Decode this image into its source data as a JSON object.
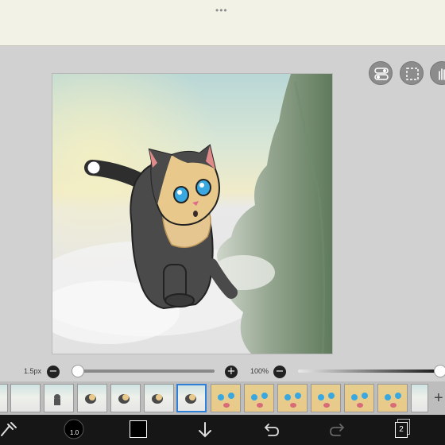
{
  "top_bar": {
    "grip_icon": "more-horizontal-icon"
  },
  "tools": {
    "icons": [
      "toggle-icon",
      "selection-icon",
      "hand-icon"
    ]
  },
  "brush": {
    "size_label": "1.5px",
    "size_level_fraction": 0.0,
    "opacity_label": "100%",
    "opacity_level_fraction": 1.0
  },
  "frames": {
    "count_visible": 13,
    "selected_index": 5,
    "add_icon": "plus-icon"
  },
  "bottom_bar": {
    "icons": [
      "brush-tool-icon",
      "brush-preview-icon",
      "color-swatch-icon",
      "download-icon",
      "undo-icon",
      "redo-icon",
      "layers-icon"
    ],
    "layer_count": "2",
    "brush_number": "1.0",
    "color": "#000000"
  },
  "colors": {
    "accent": "#2f7fd8",
    "topbar": "#f3f2e7",
    "workspace": "#d1d1d1",
    "bottombar": "#161616"
  }
}
